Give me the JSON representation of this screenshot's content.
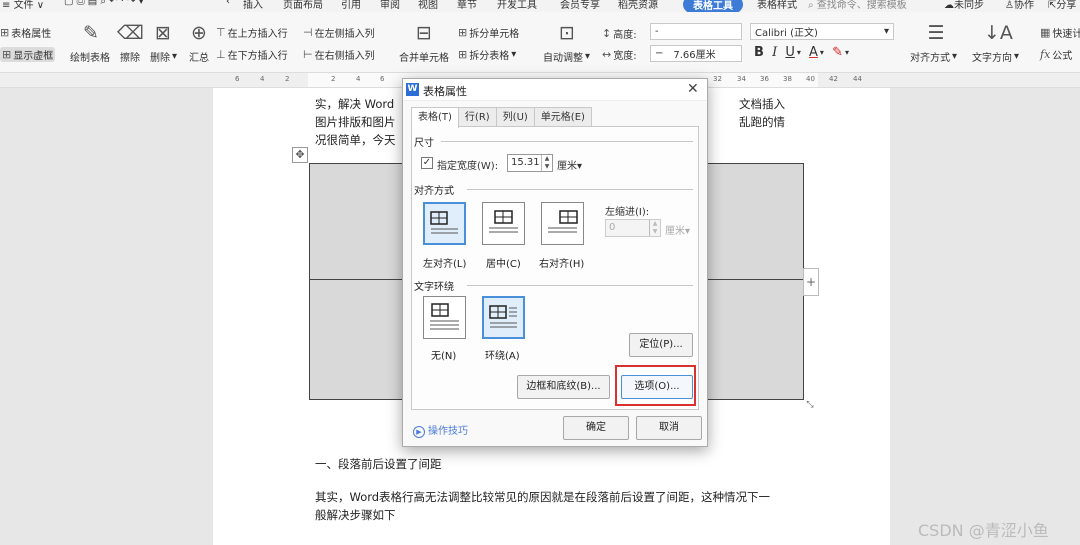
{
  "menubar": {
    "file": "文件",
    "insert": "插入",
    "layout": "页面布局",
    "reference": "引用",
    "review": "审阅",
    "view": "视图",
    "chapter": "章节",
    "dev": "开发工具",
    "vip": "会员专享",
    "template": "稻壳资源",
    "table_tools": "表格工具",
    "table_style": "表格样式",
    "search_placeholder": "查找命令、搜索模板",
    "sync": "未同步",
    "collab": "协作",
    "share": "分享"
  },
  "ribbon": {
    "table_props": "表格属性",
    "show_grid": "显示虚框",
    "draw_table": "绘制表格",
    "erase": "擦除",
    "delete": "删除",
    "summary": "汇总",
    "insert_above": "在上方插入行",
    "insert_below": "在下方插入行",
    "insert_left": "在左侧插入列",
    "insert_right": "在右侧插入列",
    "merge_cells": "合并单元格",
    "split_cells": "拆分单元格",
    "split_table": "拆分表格",
    "auto_adjust": "自动调整",
    "height_label": "高度:",
    "height_value": "-",
    "width_label": "宽度:",
    "width_value": "7.66厘米",
    "font_name": "Calibri (正文)",
    "bold": "B",
    "italic": "I",
    "underline": "U",
    "font_color": "A",
    "align_mode": "对齐方式",
    "text_dir": "文字方向",
    "quick_calc": "快速计算",
    "formula": "公式"
  },
  "ruler": [
    "6",
    "4",
    "2",
    "2",
    "4",
    "6",
    "8",
    "10",
    "12",
    "14",
    "16",
    "18",
    "20",
    "22",
    "24",
    "26",
    "28",
    "30",
    "32",
    "34",
    "36",
    "38",
    "40",
    "42",
    "44",
    "46"
  ],
  "document": {
    "line1_a": "实，解决 Word",
    "line1_b": "文档插入",
    "line2_a": "图片排版和图片",
    "line2_b": "乱跑的情",
    "line3_a": "况很简单，今天",
    "heading": "一、段落前后设置了间距",
    "para1": "其实，Word表格行高无法调整比较常见的原因就是在段落前后设置了间距，这种情况下一",
    "para2": "般解决步骤如下"
  },
  "dialog": {
    "title": "表格属性",
    "tabs": [
      "表格(T)",
      "行(R)",
      "列(U)",
      "单元格(E)"
    ],
    "size_section": "尺寸",
    "specify_width": "指定宽度(W):",
    "width_value": "15.31",
    "width_unit": "厘米▾",
    "align_section": "对齐方式",
    "align_left": "左对齐(L)",
    "align_center": "居中(C)",
    "align_right": "右对齐(H)",
    "left_indent": "左缩进(I):",
    "indent_value": "0",
    "indent_unit": "厘米▾",
    "wrap_section": "文字环绕",
    "wrap_none": "无(N)",
    "wrap_around": "环绕(A)",
    "position_btn": "定位(P)...",
    "borders_btn": "边框和底纹(B)...",
    "options_btn": "选项(O)...",
    "tips": "操作技巧",
    "ok_btn": "确定",
    "cancel_btn": "取消"
  },
  "watermark": "CSDN @青涩小鱼"
}
